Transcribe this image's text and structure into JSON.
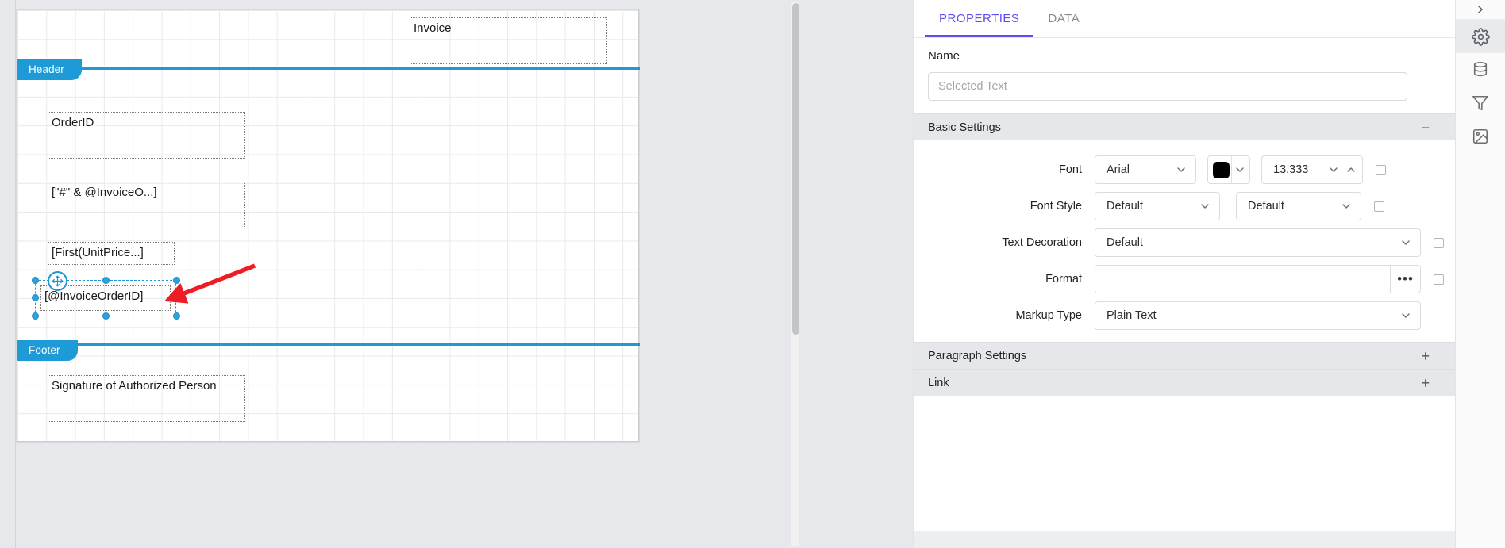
{
  "canvas": {
    "sections": [
      {
        "id": "header",
        "label": "Header"
      },
      {
        "id": "footer",
        "label": "Footer"
      }
    ],
    "items": [
      {
        "id": "invoice-title",
        "text": "Invoice"
      },
      {
        "id": "orderid-label",
        "text": "OrderID"
      },
      {
        "id": "invoice-no-expr",
        "text": "[\"#\" & @InvoiceO...]"
      },
      {
        "id": "unitprice-expr",
        "text": "[First(UnitPrice...]"
      },
      {
        "id": "invoiceorderid",
        "text": "[@InvoiceOrderID]"
      },
      {
        "id": "signature-label",
        "text": "Signature of Authorized Person"
      }
    ],
    "selected_item_text": "[@InvoiceOrderID]",
    "annotation": {
      "type": "arrow",
      "color": "#ee1c24"
    },
    "section_color": "#1e9bd7"
  },
  "properties_panel": {
    "tabs": [
      {
        "id": "properties",
        "label": "PROPERTIES",
        "active": true
      },
      {
        "id": "data",
        "label": "DATA",
        "active": false
      }
    ],
    "accent_color": "#5b4ff0",
    "name": {
      "label": "Name",
      "value": "",
      "placeholder": "Selected Text"
    },
    "sections": [
      {
        "id": "basic-settings",
        "label": "Basic Settings",
        "expanded": true,
        "toggle": "−"
      },
      {
        "id": "paragraph-settings",
        "label": "Paragraph Settings",
        "expanded": false,
        "toggle": "+"
      },
      {
        "id": "link",
        "label": "Link",
        "expanded": false,
        "toggle": "+"
      }
    ],
    "basic_settings": {
      "font": {
        "label": "Font",
        "family": "Arial",
        "color": "#000000",
        "size": "13.333"
      },
      "font_style": {
        "label": "Font Style",
        "value": "Default",
        "value2": "Default"
      },
      "text_decoration": {
        "label": "Text Decoration",
        "value": "Default"
      },
      "format": {
        "label": "Format",
        "value": "",
        "button": "•••"
      },
      "markup_type": {
        "label": "Markup Type",
        "value": "Plain Text"
      }
    }
  },
  "icon_rail": {
    "items": [
      {
        "id": "expand",
        "icon": "chevron-right-icon",
        "active": false
      },
      {
        "id": "properties",
        "icon": "gear-icon",
        "active": true
      },
      {
        "id": "data",
        "icon": "database-icon",
        "active": false
      },
      {
        "id": "filter",
        "icon": "filter-icon",
        "active": false
      },
      {
        "id": "image",
        "icon": "image-settings-icon",
        "active": false
      }
    ]
  }
}
